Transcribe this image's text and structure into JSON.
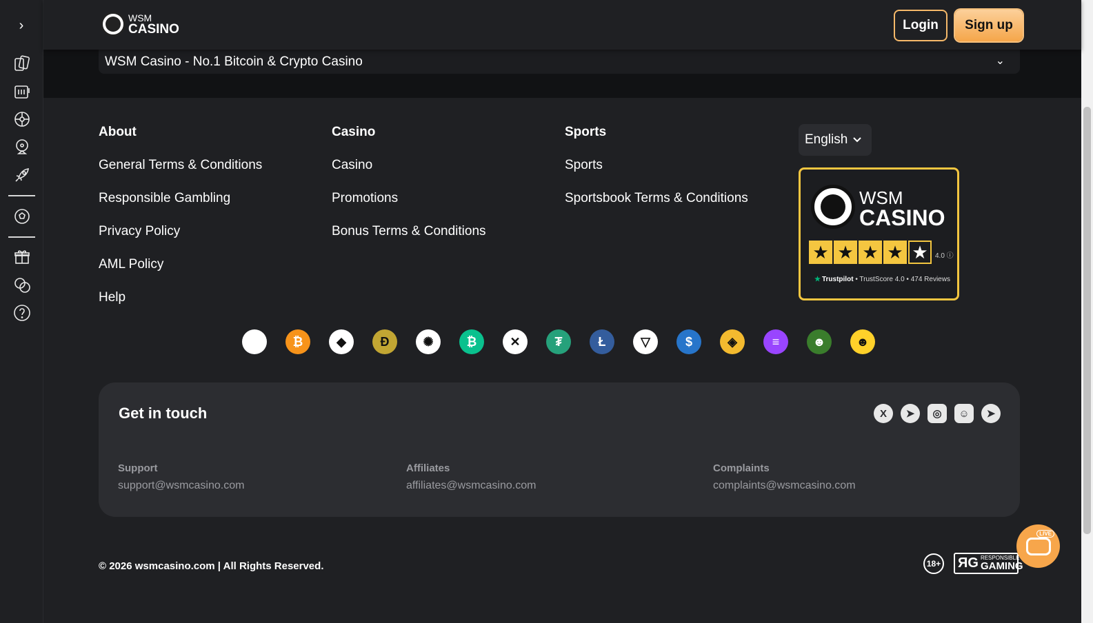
{
  "header": {
    "logo_line1": "WSM",
    "logo_line2": "CASINO",
    "login_label": "Login",
    "signup_label": "Sign up"
  },
  "sidebar": {
    "toggle": "›",
    "icons": [
      "cards-icon",
      "slots-icon",
      "roulette-icon",
      "wheel-icon",
      "rocket-icon",
      "soccer-ball-icon",
      "gift-icon",
      "crypto-exchange-icon",
      "help-icon"
    ]
  },
  "accordion": {
    "title": "WSM Casino - No.1 Bitcoin & Crypto Casino",
    "chevron": "⌄"
  },
  "footer": {
    "about": {
      "title": "About",
      "links": [
        "General Terms & Conditions",
        "Responsible Gambling",
        "Privacy Policy",
        "AML Policy",
        "Help"
      ]
    },
    "casino": {
      "title": "Casino",
      "links": [
        "Casino",
        "Promotions",
        "Bonus Terms & Conditions"
      ]
    },
    "sports": {
      "title": "Sports",
      "links": [
        "Sports",
        "Sportsbook Terms & Conditions"
      ]
    },
    "language": "English"
  },
  "trustpilot": {
    "brand_line1": "WSM",
    "brand_line2": "CASINO",
    "rating": "4.0 ⓘ",
    "source": "Trustpilot",
    "trustscore": "TrustScore 4.0",
    "reviews": "474 Reviews",
    "stars": 4
  },
  "coins": [
    {
      "name": "wsm-coin-icon",
      "glyph": "",
      "color": "#ffffff"
    },
    {
      "name": "bitcoin-icon",
      "glyph": "₿",
      "color": "#f7931a"
    },
    {
      "name": "ethereum-icon",
      "glyph": "◆",
      "color": "#ffffff"
    },
    {
      "name": "dogecoin-icon",
      "glyph": "Ð",
      "color": "#c2a633"
    },
    {
      "name": "cardano-icon",
      "glyph": "✺",
      "color": "#ffffff"
    },
    {
      "name": "bitcoin-cash-icon",
      "glyph": "₿",
      "color": "#0ac18e"
    },
    {
      "name": "xrp-icon",
      "glyph": "✕",
      "color": "#ffffff"
    },
    {
      "name": "tether-icon",
      "glyph": "₮",
      "color": "#26a17b"
    },
    {
      "name": "litecoin-icon",
      "glyph": "Ł",
      "color": "#345d9d"
    },
    {
      "name": "tron-icon",
      "glyph": "▽",
      "color": "#ffffff"
    },
    {
      "name": "usdc-icon",
      "glyph": "$",
      "color": "#2775ca"
    },
    {
      "name": "bnb-icon",
      "glyph": "◈",
      "color": "#f3ba2f"
    },
    {
      "name": "solana-icon",
      "glyph": "≡",
      "color": "#9945ff"
    },
    {
      "name": "pepe-icon",
      "glyph": "☻",
      "color": "#3a7d2c"
    },
    {
      "name": "shiba-icon",
      "glyph": "☻",
      "color": "#ffd12a"
    }
  ],
  "contact": {
    "title": "Get in touch",
    "support_label": "Support",
    "support_email": "support@wsmcasino.com",
    "affiliates_label": "Affiliates",
    "affiliates_email": "affiliates@wsmcasino.com",
    "complaints_label": "Complaints",
    "complaints_email": "complaints@wsmcasino.com",
    "socials": [
      {
        "name": "x-twitter-icon",
        "glyph": "X"
      },
      {
        "name": "telegram-icon",
        "glyph": "➤"
      },
      {
        "name": "instagram-icon",
        "glyph": "◎"
      },
      {
        "name": "discord-icon",
        "glyph": "☺"
      },
      {
        "name": "telegram-channel-icon",
        "glyph": "➤"
      }
    ]
  },
  "bottom": {
    "copyright": "© 2026 wsmcasino.com | All Rights Reserved.",
    "age_badge": "18+",
    "rg_mark": "ЯG",
    "rg_line1": "RESPONSIBLE",
    "rg_line2": "GAMING",
    "live_tag": "LIVE"
  },
  "colors": {
    "accent": "#f5a64a",
    "background": "#1f2023",
    "panel": "#2c2d31",
    "trustpilot_star": "#f4c640"
  }
}
